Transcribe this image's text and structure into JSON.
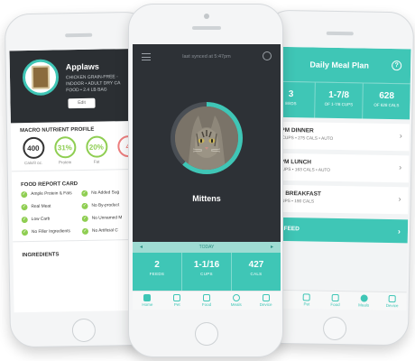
{
  "colors": {
    "teal": "#3fc6b6",
    "dark": "#2d3136",
    "green": "#8fce52",
    "red": "#ef7f7f"
  },
  "left": {
    "food_name": "Applaws",
    "food_desc": "CHICKEN GRAIN-FREE -\nINDOOR • ADULT DRY CA\nFOOD • 2.4 LB BAG",
    "edit_label": "Edit",
    "macro_title": "MACRO NUTRIENT PROFILE",
    "macros": [
      {
        "value": "400",
        "label": "Cals/8 oz."
      },
      {
        "value": "31%",
        "label": "Protein"
      },
      {
        "value": "20%",
        "label": "Fat"
      },
      {
        "value": "4",
        "label": ""
      }
    ],
    "report_title": "FOOD REPORT CARD",
    "report": [
      "Ample Protein & Fats",
      "No Added Sug",
      "Real Meat",
      "No By-product",
      "Low Carb",
      "No Unnamed M",
      "No Filler Ingredients",
      "No Artificial C"
    ],
    "ingredients_title": "INGREDIENTS"
  },
  "center": {
    "sync_text": "last synced at 5:47pm",
    "pet_name": "Mittens",
    "today_label": "TODAY",
    "stats": [
      {
        "value": "2",
        "label": "FEEDS"
      },
      {
        "value": "1-1/16",
        "label": "CUPS"
      },
      {
        "value": "427",
        "label": "CALS"
      }
    ],
    "tabs": [
      "Home",
      "Pet",
      "Food",
      "Meals",
      "Device"
    ]
  },
  "right": {
    "title": "Daily Meal Plan",
    "help_glyph": "?",
    "stats": [
      {
        "value": "3",
        "label": "EEDS"
      },
      {
        "value": "1-7/8",
        "label": "OF 1-7/8 CUPS"
      },
      {
        "value": "628",
        "label": "OF 628 CALS"
      }
    ],
    "meals": [
      {
        "title": ":30PM DINNER",
        "detail": "1/16 CUPS • 275 CALS • AUTO"
      },
      {
        "title": ":30PM LUNCH",
        "detail": "3/4 CUPS • 163 CALS • AUTO"
      },
      {
        "title": "0AM BREAKFAST",
        "detail": "/16 CUPS • 190 CALS"
      }
    ],
    "add_feed": "D A FEED",
    "tabs": [
      "",
      "Pet",
      "Food",
      "Meals",
      "Device"
    ]
  }
}
